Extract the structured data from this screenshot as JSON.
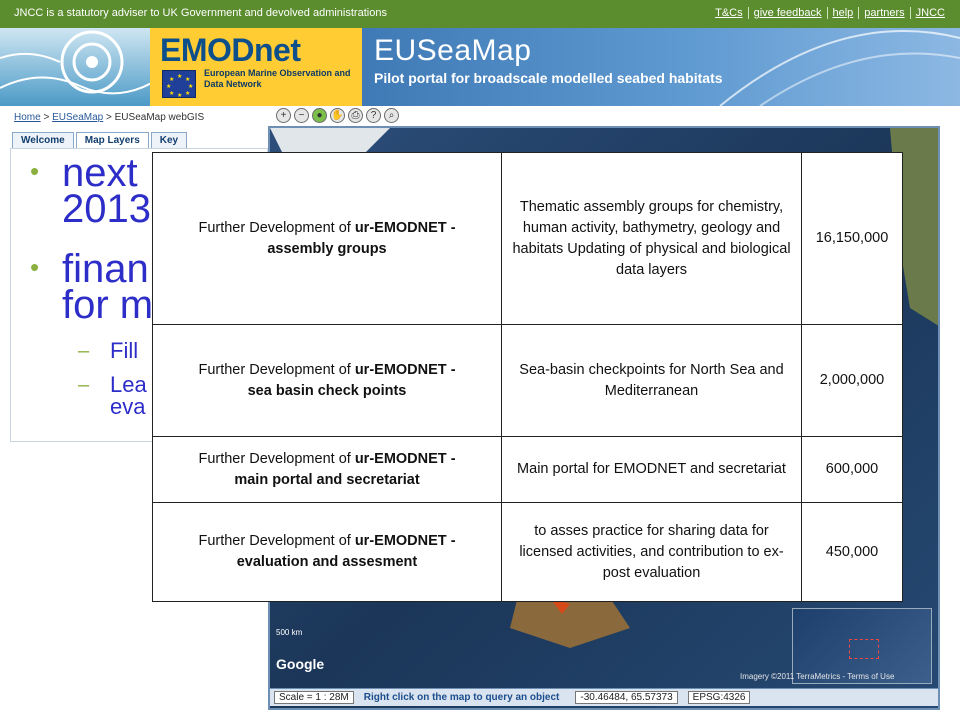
{
  "topbar": {
    "notice": "JNCC is a statutory adviser to UK Government and devolved administrations",
    "links": [
      "T&Cs",
      "give feedback",
      "help",
      "partners",
      "JNCC"
    ]
  },
  "banner": {
    "emodnet_title": "EMODnet",
    "emodnet_subtitle": "European Marine Observation and Data Network",
    "site_title": "EUSeaMap",
    "site_subtitle": "Pilot portal for broadscale modelled seabed habitats"
  },
  "breadcrumb": {
    "items": [
      "Home",
      "EUSeaMap",
      "EUSeaMap webGIS"
    ]
  },
  "tabs": [
    "Welcome",
    "Map Layers",
    "Key"
  ],
  "statusbar": {
    "scale": "Scale = 1 : 28M",
    "hint": "Right click on the map to query an object",
    "coords": "-30.46484, 65.57373",
    "epsg": "EPSG:4326"
  },
  "map": {
    "copyright": "Imagery ©2011 TerraMetrics - Terms of Use",
    "scale_label": "500 km",
    "google": "Google"
  },
  "slide": {
    "bullet1": "next",
    "bullet1_cont": "2013",
    "bullet2": "finan",
    "bullet2_cont": "for m",
    "sub1": "Fill",
    "sub2": "Lea",
    "sub2_cont": "eva"
  },
  "table": {
    "rows": [
      {
        "label_prefix": "Further Development of ",
        "label_brand": "ur-EMODNET",
        "label_suffix": " -",
        "label_title": "assembly groups",
        "description": "Thematic assembly groups for chemistry, human activity, bathymetry, geology and habitats Updating of physical and biological data layers",
        "amount": "16,150,000"
      },
      {
        "label_prefix": "Further Development of ",
        "label_brand": "ur-EMODNET",
        "label_suffix": " -",
        "label_title": "sea basin check points",
        "description": "Sea-basin checkpoints for North Sea and Mediterranean",
        "amount": "2,000,000"
      },
      {
        "label_prefix": "Further Development of ",
        "label_brand": "ur-EMODNET",
        "label_suffix": " -",
        "label_title": "main portal and secretariat",
        "description": "Main portal for EMODNET and secretariat",
        "amount": "600,000"
      },
      {
        "label_prefix": "Further Development of ",
        "label_brand": "ur-EMODNET",
        "label_suffix": " -",
        "label_title": "evaluation and assesment",
        "description": "to asses practice for sharing data for licensed activities, and contribution to ex-post evaluation",
        "amount": "450,000"
      }
    ]
  },
  "icons": [
    "zoom-in-icon",
    "zoom-out-icon",
    "globe-icon",
    "pan-hand-icon",
    "print-icon",
    "identify-icon",
    "search-icon"
  ],
  "colors": {
    "topbar": "#5b8c2e",
    "emodnet_yellow": "#ffcc33",
    "sea_blue": "#3f7ab6",
    "slide_text": "#2d2dc8",
    "bullet_green": "#8bb040"
  }
}
